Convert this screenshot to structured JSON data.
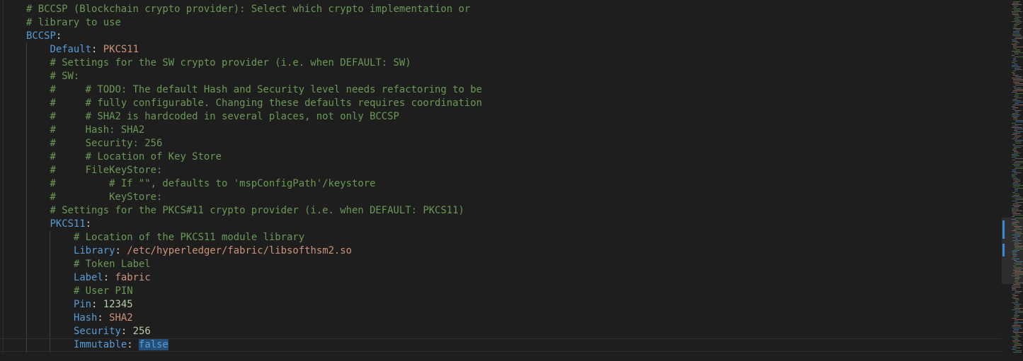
{
  "editor": {
    "lines": [
      {
        "indent": 0,
        "segments": [
          {
            "cls": "c",
            "text": "# BCCSP (Blockchain crypto provider): Select which crypto implementation or"
          }
        ]
      },
      {
        "indent": 0,
        "segments": [
          {
            "cls": "c",
            "text": "# library to use"
          }
        ]
      },
      {
        "indent": 0,
        "segments": [
          {
            "cls": "k",
            "text": "BCCSP"
          },
          {
            "cls": "p",
            "text": ":"
          }
        ]
      },
      {
        "indent": 1,
        "segments": [
          {
            "cls": "k",
            "text": "Default"
          },
          {
            "cls": "p",
            "text": ": "
          },
          {
            "cls": "s",
            "text": "PKCS11"
          }
        ]
      },
      {
        "indent": 1,
        "segments": [
          {
            "cls": "c",
            "text": "# Settings for the SW crypto provider (i.e. when DEFAULT: SW)"
          }
        ]
      },
      {
        "indent": 1,
        "segments": [
          {
            "cls": "c",
            "text": "# SW:"
          }
        ]
      },
      {
        "indent": 1,
        "segments": [
          {
            "cls": "c",
            "text": "#     # TODO: The default Hash and Security level needs refactoring to be"
          }
        ]
      },
      {
        "indent": 1,
        "segments": [
          {
            "cls": "c",
            "text": "#     # fully configurable. Changing these defaults requires coordination"
          }
        ]
      },
      {
        "indent": 1,
        "segments": [
          {
            "cls": "c",
            "text": "#     # SHA2 is hardcoded in several places, not only BCCSP"
          }
        ]
      },
      {
        "indent": 1,
        "segments": [
          {
            "cls": "c",
            "text": "#     Hash: SHA2"
          }
        ]
      },
      {
        "indent": 1,
        "segments": [
          {
            "cls": "c",
            "text": "#     Security: 256"
          }
        ]
      },
      {
        "indent": 1,
        "segments": [
          {
            "cls": "c",
            "text": "#     # Location of Key Store"
          }
        ]
      },
      {
        "indent": 1,
        "segments": [
          {
            "cls": "c",
            "text": "#     FileKeyStore:"
          }
        ]
      },
      {
        "indent": 1,
        "segments": [
          {
            "cls": "c",
            "text": "#         # If \"\", defaults to 'mspConfigPath'/keystore"
          }
        ]
      },
      {
        "indent": 1,
        "segments": [
          {
            "cls": "c",
            "text": "#         KeyStore:"
          }
        ]
      },
      {
        "indent": 1,
        "segments": [
          {
            "cls": "c",
            "text": "# Settings for the PKCS#11 crypto provider (i.e. when DEFAULT: PKCS11)"
          }
        ]
      },
      {
        "indent": 1,
        "segments": [
          {
            "cls": "k",
            "text": "PKCS11"
          },
          {
            "cls": "p",
            "text": ":"
          }
        ]
      },
      {
        "indent": 2,
        "segments": [
          {
            "cls": "c",
            "text": "# Location of the PKCS11 module library"
          }
        ]
      },
      {
        "indent": 2,
        "segments": [
          {
            "cls": "k",
            "text": "Library"
          },
          {
            "cls": "p",
            "text": ": "
          },
          {
            "cls": "s",
            "text": "/etc/hyperledger/fabric/libsofthsm2.so"
          }
        ]
      },
      {
        "indent": 2,
        "segments": [
          {
            "cls": "c",
            "text": "# Token Label"
          }
        ]
      },
      {
        "indent": 2,
        "segments": [
          {
            "cls": "k",
            "text": "Label"
          },
          {
            "cls": "p",
            "text": ": "
          },
          {
            "cls": "s",
            "text": "fabric"
          }
        ]
      },
      {
        "indent": 2,
        "segments": [
          {
            "cls": "c",
            "text": "# User PIN"
          }
        ]
      },
      {
        "indent": 2,
        "segments": [
          {
            "cls": "k",
            "text": "Pin"
          },
          {
            "cls": "p",
            "text": ": "
          },
          {
            "cls": "n",
            "text": "12345"
          }
        ]
      },
      {
        "indent": 2,
        "segments": [
          {
            "cls": "k",
            "text": "Hash"
          },
          {
            "cls": "p",
            "text": ": "
          },
          {
            "cls": "s",
            "text": "SHA2"
          }
        ]
      },
      {
        "indent": 2,
        "segments": [
          {
            "cls": "k",
            "text": "Security"
          },
          {
            "cls": "p",
            "text": ": "
          },
          {
            "cls": "n",
            "text": "256"
          }
        ]
      },
      {
        "indent": 2,
        "current": true,
        "segments": [
          {
            "cls": "k",
            "text": "Immutable"
          },
          {
            "cls": "p",
            "text": ": "
          },
          {
            "cls": "sel",
            "text": "false"
          }
        ]
      }
    ]
  },
  "colors": {
    "background": "#1e1e1e",
    "comment": "#6a9955",
    "key": "#569cd6",
    "string": "#ce9178",
    "number": "#b5cea8",
    "selection": "#264f78"
  }
}
